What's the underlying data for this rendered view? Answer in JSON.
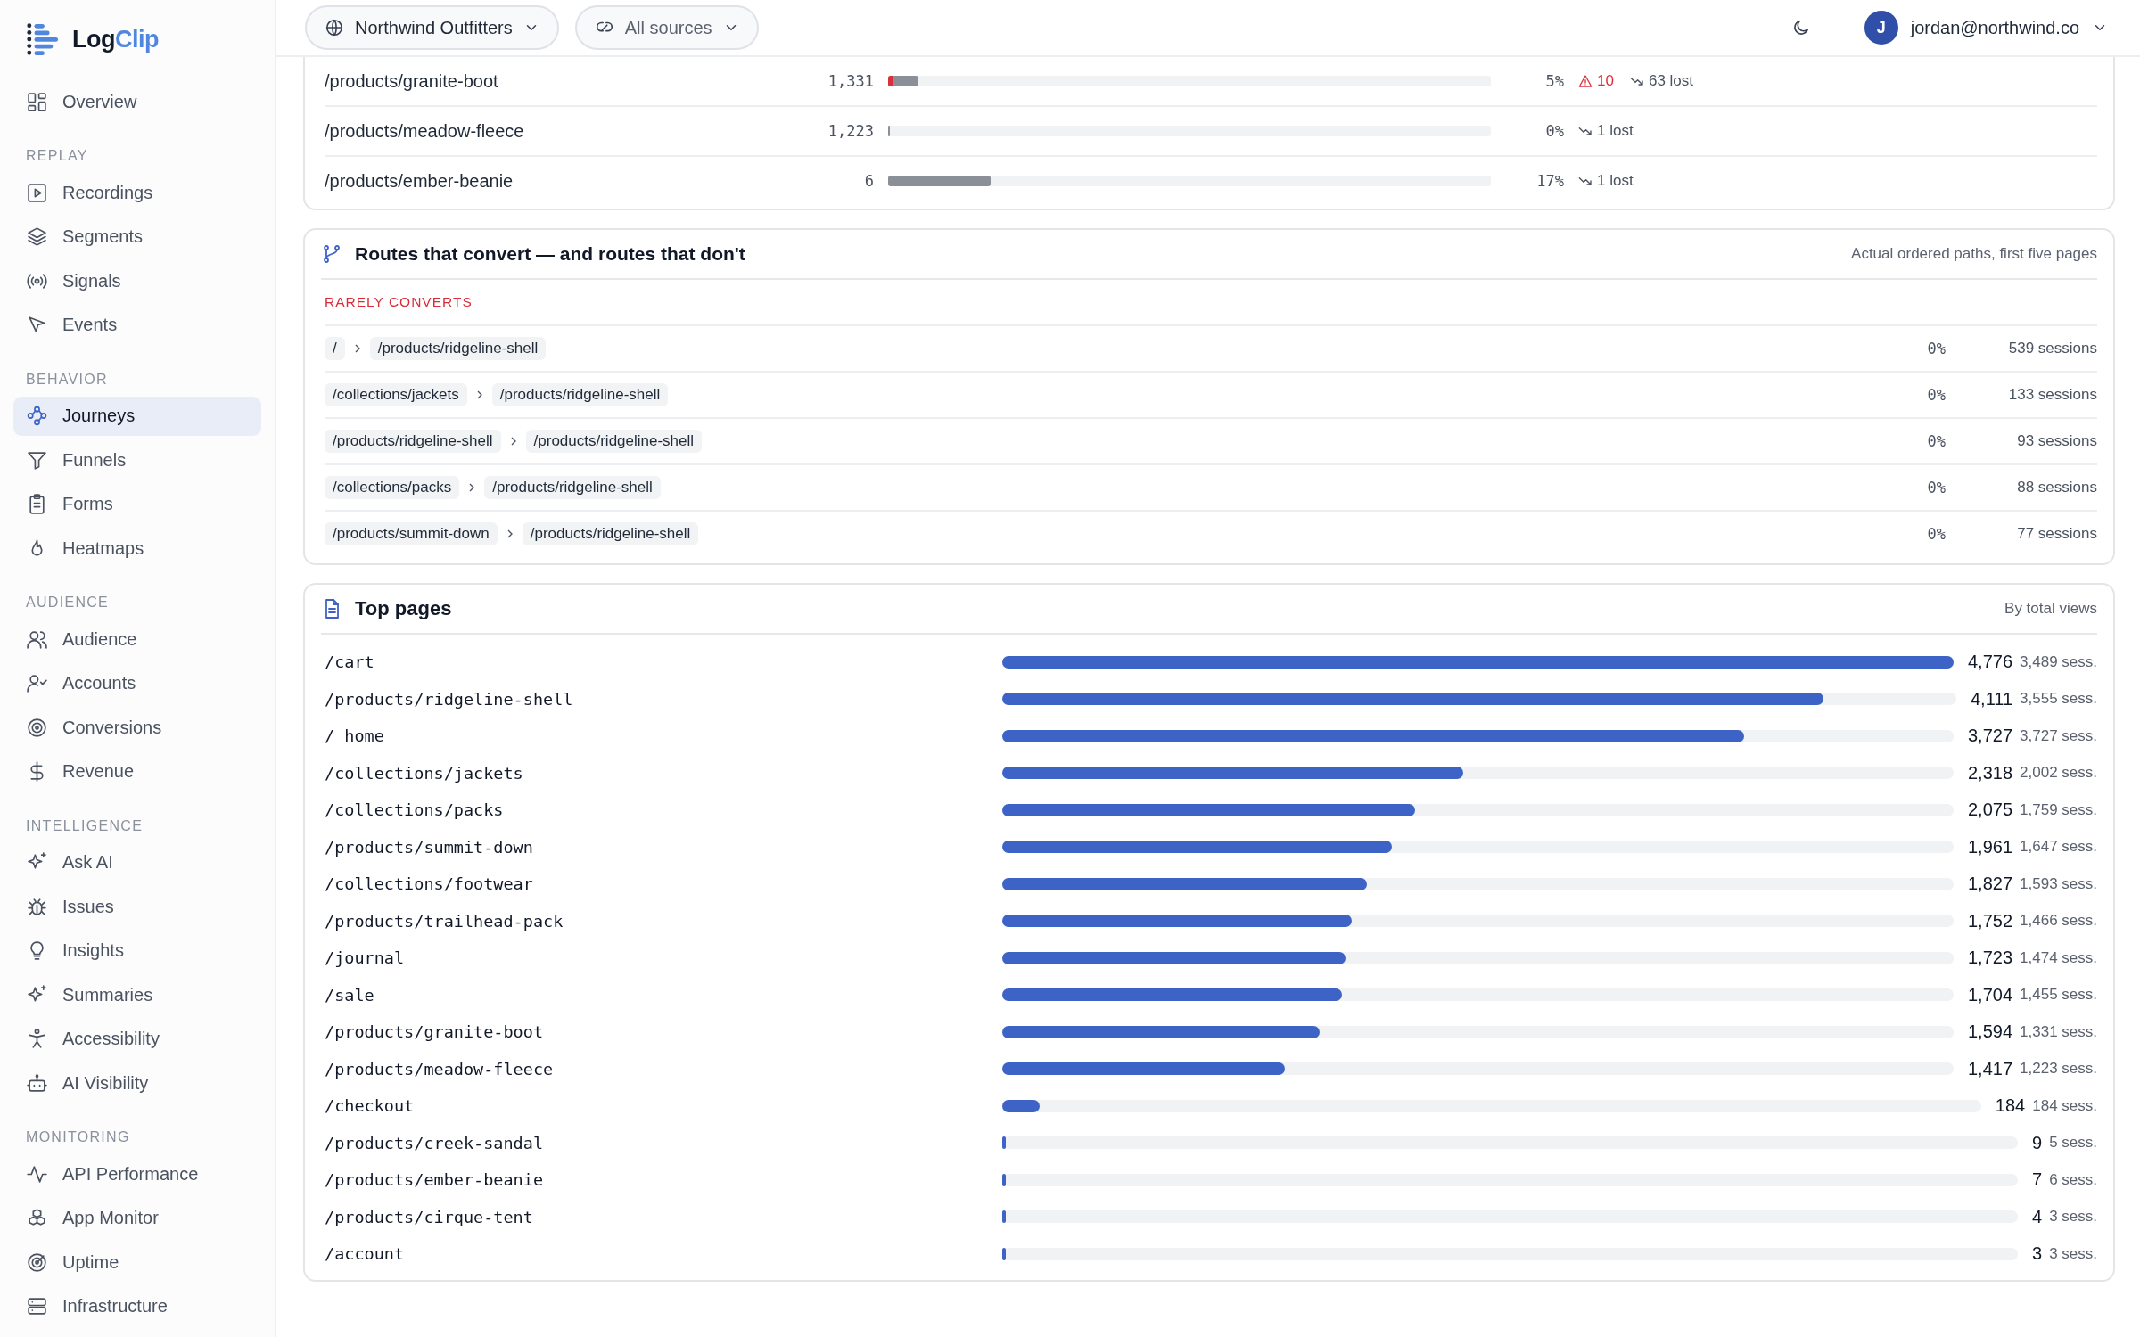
{
  "brand": {
    "name": "Log",
    "accent": "Clip"
  },
  "sidebar": {
    "items": [
      {
        "label": "Overview",
        "selected": false
      }
    ],
    "sections": [
      {
        "title": "REPLAY",
        "items": [
          {
            "label": "Recordings",
            "selected": false
          },
          {
            "label": "Segments",
            "selected": false
          },
          {
            "label": "Signals",
            "selected": false
          },
          {
            "label": "Events",
            "selected": false
          }
        ]
      },
      {
        "title": "BEHAVIOR",
        "items": [
          {
            "label": "Journeys",
            "selected": true
          },
          {
            "label": "Funnels",
            "selected": false
          },
          {
            "label": "Forms",
            "selected": false
          },
          {
            "label": "Heatmaps",
            "selected": false
          }
        ]
      },
      {
        "title": "AUDIENCE",
        "items": [
          {
            "label": "Audience",
            "selected": false
          },
          {
            "label": "Accounts",
            "selected": false
          },
          {
            "label": "Conversions",
            "selected": false
          },
          {
            "label": "Revenue",
            "selected": false
          }
        ]
      },
      {
        "title": "INTELLIGENCE",
        "items": [
          {
            "label": "Ask AI",
            "selected": false
          },
          {
            "label": "Issues",
            "selected": false
          },
          {
            "label": "Insights",
            "selected": false
          },
          {
            "label": "Summaries",
            "selected": false
          },
          {
            "label": "Accessibility",
            "selected": false
          },
          {
            "label": "AI Visibility",
            "selected": false
          }
        ]
      },
      {
        "title": "MONITORING",
        "items": [
          {
            "label": "API Performance",
            "selected": false
          },
          {
            "label": "App Monitor",
            "selected": false
          },
          {
            "label": "Uptime",
            "selected": false
          },
          {
            "label": "Infrastructure",
            "selected": false
          }
        ]
      }
    ]
  },
  "topbar": {
    "workspace": "Northwind Outfitters",
    "source": "All sources",
    "user_initial": "J",
    "user_email": "jordan@northwind.co"
  },
  "page_table": {
    "rows": [
      {
        "path": "/products/granite-boot",
        "views": "1,331",
        "level": 0.05,
        "percent": "5%",
        "warning": "10",
        "lost": "63 lost"
      },
      {
        "path": "/products/meadow-fleece",
        "views": "1,223",
        "level": 0.0,
        "percent": "0%",
        "lost": "1 lost"
      },
      {
        "path": "/products/ember-beanie",
        "views": "6",
        "level": 0.17,
        "percent": "17%",
        "lost": "1 lost"
      }
    ]
  },
  "routes": {
    "title": "Routes that convert — and routes that don't",
    "subtitle": "Actual ordered paths, first five pages",
    "group_label": "RARELY CONVERTS",
    "rows": [
      {
        "steps": [
          "/",
          "/products/ridgeline-shell"
        ],
        "rate": "0%",
        "sessions": "539 sessions"
      },
      {
        "steps": [
          "/collections/jackets",
          "/products/ridgeline-shell"
        ],
        "rate": "0%",
        "sessions": "133 sessions"
      },
      {
        "steps": [
          "/products/ridgeline-shell",
          "/products/ridgeline-shell"
        ],
        "rate": "0%",
        "sessions": "93 sessions"
      },
      {
        "steps": [
          "/collections/packs",
          "/products/ridgeline-shell"
        ],
        "rate": "0%",
        "sessions": "88 sessions"
      },
      {
        "steps": [
          "/products/summit-down",
          "/products/ridgeline-shell"
        ],
        "rate": "0%",
        "sessions": "77 sessions"
      }
    ]
  },
  "top_pages": {
    "title": "Top pages",
    "subtitle": "By total views",
    "rows": [
      {
        "path": "/cart",
        "views": "4,776",
        "sessions": "3,489 sess.",
        "level": 1.0
      },
      {
        "path": "/products/ridgeline-shell",
        "views": "4,111",
        "sessions": "3,555 sess.",
        "level": 0.861
      },
      {
        "path": "/ home",
        "views": "3,727",
        "sessions": "3,727 sess.",
        "level": 0.78
      },
      {
        "path": "/collections/jackets",
        "views": "2,318",
        "sessions": "2,002 sess.",
        "level": 0.485
      },
      {
        "path": "/collections/packs",
        "views": "2,075",
        "sessions": "1,759 sess.",
        "level": 0.434
      },
      {
        "path": "/products/summit-down",
        "views": "1,961",
        "sessions": "1,647 sess.",
        "level": 0.41
      },
      {
        "path": "/collections/footwear",
        "views": "1,827",
        "sessions": "1,593 sess.",
        "level": 0.383
      },
      {
        "path": "/products/trailhead-pack",
        "views": "1,752",
        "sessions": "1,466 sess.",
        "level": 0.367
      },
      {
        "path": "/journal",
        "views": "1,723",
        "sessions": "1,474 sess.",
        "level": 0.361
      },
      {
        "path": "/sale",
        "views": "1,704",
        "sessions": "1,455 sess.",
        "level": 0.357
      },
      {
        "path": "/products/granite-boot",
        "views": "1,594",
        "sessions": "1,331 sess.",
        "level": 0.334
      },
      {
        "path": "/products/meadow-fleece",
        "views": "1,417",
        "sessions": "1,223 sess.",
        "level": 0.297
      },
      {
        "path": "/checkout",
        "views": "184",
        "sessions": "184 sess.",
        "level": 0.0385
      },
      {
        "path": "/products/creek-sandal",
        "views": "9",
        "sessions": "5 sess.",
        "level": 0.002
      },
      {
        "path": "/products/ember-beanie",
        "views": "7",
        "sessions": "6 sess.",
        "level": 0.0015
      },
      {
        "path": "/products/cirque-tent",
        "views": "4",
        "sessions": "3 sess.",
        "level": 0.001
      },
      {
        "path": "/account",
        "views": "3",
        "sessions": "3 sess.",
        "level": 0.0006
      }
    ]
  }
}
